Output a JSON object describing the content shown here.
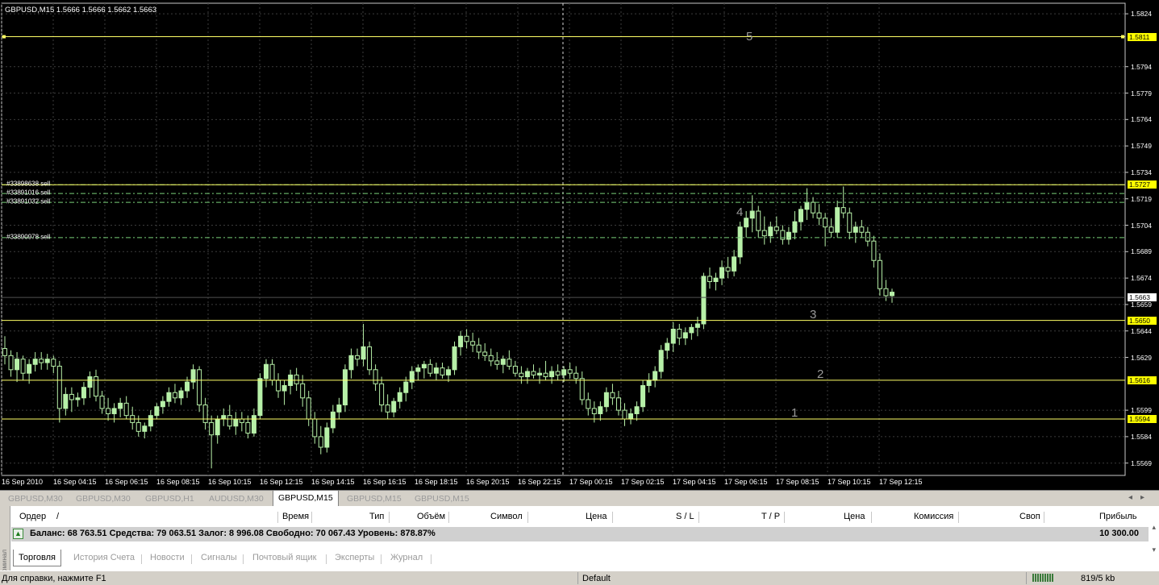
{
  "chart": {
    "header": "GBPUSD,M15  1.5666 1.5666 1.5662 1.5663",
    "price_axis": [
      "1.5824",
      "1.5794",
      "1.5779",
      "1.5764",
      "1.5749",
      "1.5734",
      "1.5719",
      "1.5704",
      "1.5689",
      "1.5674",
      "1.5659",
      "1.5644",
      "1.5629",
      "1.5599",
      "1.5584",
      "1.5569"
    ],
    "highlight_prices": [
      {
        "value": "1.5811",
        "kind": "level"
      },
      {
        "value": "1.5727",
        "kind": "level"
      },
      {
        "value": "1.5663",
        "kind": "current"
      },
      {
        "value": "1.5650",
        "kind": "level"
      },
      {
        "value": "1.5616",
        "kind": "level"
      },
      {
        "value": "1.5594",
        "kind": "level"
      }
    ],
    "time_axis": [
      "16 Sep 2010",
      "16 Sep 04:15",
      "16 Sep 06:15",
      "16 Sep 08:15",
      "16 Sep 10:15",
      "16 Sep 12:15",
      "16 Sep 14:15",
      "16 Sep 16:15",
      "16 Sep 18:15",
      "16 Sep 20:15",
      "16 Sep 22:15",
      "17 Sep 00:15",
      "17 Sep 02:15",
      "17 Sep 04:15",
      "17 Sep 06:15",
      "17 Sep 08:15",
      "17 Sep 10:15",
      "17 Sep 12:15"
    ],
    "order_labels": [
      {
        "text": "#33898638 sell",
        "price": 1.5727
      },
      {
        "text": "#33891016 sell",
        "price": 1.5722
      },
      {
        "text": "#33891032 sell",
        "price": 1.5717
      },
      {
        "text": "#33890978 sell",
        "price": 1.5697
      }
    ],
    "level_numbers": [
      {
        "text": "5",
        "price": 1.5811
      },
      {
        "text": "4",
        "price": 1.5711
      },
      {
        "text": "3",
        "price": 1.5653
      },
      {
        "text": "2",
        "price": 1.5619
      },
      {
        "text": "1",
        "price": 1.5597
      }
    ],
    "colors": {
      "background": "#000000",
      "grid": "#3c3c3c",
      "level": "#ffff66",
      "order_line": "#7ad07a",
      "candle": "#b7f0a8"
    }
  },
  "chart_data": {
    "type": "candlestick",
    "symbol": "GBPUSD",
    "timeframe": "M15",
    "ylim": [
      1.5562,
      1.583
    ],
    "candles": [
      [
        1.5634,
        1.5641,
        1.5625,
        1.563
      ],
      [
        1.563,
        1.5633,
        1.5618,
        1.5622
      ],
      [
        1.5622,
        1.5632,
        1.5615,
        1.5628
      ],
      [
        1.5628,
        1.563,
        1.5616,
        1.562
      ],
      [
        1.562,
        1.5628,
        1.5614,
        1.5625
      ],
      [
        1.5625,
        1.5632,
        1.5621,
        1.5628
      ],
      [
        1.5628,
        1.5632,
        1.5622,
        1.5626
      ],
      [
        1.5626,
        1.5631,
        1.5622,
        1.5628
      ],
      [
        1.5628,
        1.563,
        1.562,
        1.5624
      ],
      [
        1.5624,
        1.5627,
        1.5592,
        1.56
      ],
      [
        1.56,
        1.5612,
        1.5596,
        1.5608
      ],
      [
        1.5608,
        1.5612,
        1.5598,
        1.5605
      ],
      [
        1.5605,
        1.5609,
        1.5601,
        1.5606
      ],
      [
        1.5606,
        1.5615,
        1.5602,
        1.5612
      ],
      [
        1.5612,
        1.5621,
        1.5606,
        1.5618
      ],
      [
        1.5618,
        1.5622,
        1.5604,
        1.5607
      ],
      [
        1.5607,
        1.561,
        1.5597,
        1.56
      ],
      [
        1.56,
        1.5606,
        1.5593,
        1.5597
      ],
      [
        1.5597,
        1.5603,
        1.5592,
        1.56
      ],
      [
        1.56,
        1.5606,
        1.5595,
        1.5603
      ],
      [
        1.5603,
        1.5607,
        1.5594,
        1.5596
      ],
      [
        1.5596,
        1.5601,
        1.5588,
        1.5592
      ],
      [
        1.5592,
        1.5596,
        1.5584,
        1.5587
      ],
      [
        1.5587,
        1.5592,
        1.5583,
        1.559
      ],
      [
        1.559,
        1.5599,
        1.5587,
        1.5596
      ],
      [
        1.5596,
        1.5603,
        1.5594,
        1.5601
      ],
      [
        1.5601,
        1.5607,
        1.5597,
        1.5604
      ],
      [
        1.5604,
        1.5612,
        1.5601,
        1.5609
      ],
      [
        1.5609,
        1.5614,
        1.5603,
        1.5606
      ],
      [
        1.5606,
        1.5612,
        1.5602,
        1.561
      ],
      [
        1.561,
        1.5618,
        1.5606,
        1.5615
      ],
      [
        1.5615,
        1.5625,
        1.5611,
        1.5622
      ],
      [
        1.5622,
        1.5624,
        1.5598,
        1.5602
      ],
      [
        1.5602,
        1.5606,
        1.5588,
        1.5592
      ],
      [
        1.5592,
        1.5596,
        1.5566,
        1.5585
      ],
      [
        1.5585,
        1.5596,
        1.558,
        1.5594
      ],
      [
        1.5594,
        1.56,
        1.559,
        1.5596
      ],
      [
        1.5596,
        1.5602,
        1.5588,
        1.559
      ],
      [
        1.559,
        1.5598,
        1.5585,
        1.5594
      ],
      [
        1.5594,
        1.5598,
        1.5587,
        1.5592
      ],
      [
        1.5592,
        1.5596,
        1.5583,
        1.5586
      ],
      [
        1.5586,
        1.56,
        1.5584,
        1.5596
      ],
      [
        1.5596,
        1.562,
        1.5594,
        1.5617
      ],
      [
        1.5617,
        1.5628,
        1.5612,
        1.5625
      ],
      [
        1.5625,
        1.5628,
        1.5613,
        1.5616
      ],
      [
        1.5616,
        1.562,
        1.5606,
        1.561
      ],
      [
        1.561,
        1.5616,
        1.5602,
        1.5613
      ],
      [
        1.5613,
        1.5622,
        1.5608,
        1.5619
      ],
      [
        1.5619,
        1.5623,
        1.561,
        1.5614
      ],
      [
        1.5614,
        1.5619,
        1.5601,
        1.5606
      ],
      [
        1.5606,
        1.561,
        1.559,
        1.5594
      ],
      [
        1.5594,
        1.5598,
        1.558,
        1.5584
      ],
      [
        1.5584,
        1.559,
        1.5574,
        1.5578
      ],
      [
        1.5578,
        1.5592,
        1.5575,
        1.5589
      ],
      [
        1.5589,
        1.5602,
        1.5586,
        1.5598
      ],
      [
        1.5598,
        1.5606,
        1.5594,
        1.5602
      ],
      [
        1.5602,
        1.5625,
        1.5598,
        1.5622
      ],
      [
        1.5622,
        1.5634,
        1.5617,
        1.563
      ],
      [
        1.563,
        1.5634,
        1.5624,
        1.5628
      ],
      [
        1.5628,
        1.5648,
        1.5624,
        1.5635
      ],
      [
        1.5635,
        1.5638,
        1.5619,
        1.5622
      ],
      [
        1.5622,
        1.5625,
        1.561,
        1.5614
      ],
      [
        1.5614,
        1.5618,
        1.5598,
        1.5602
      ],
      [
        1.5602,
        1.5608,
        1.5594,
        1.5598
      ],
      [
        1.5598,
        1.5606,
        1.5595,
        1.5604
      ],
      [
        1.5604,
        1.5612,
        1.56,
        1.5609
      ],
      [
        1.5609,
        1.5618,
        1.5604,
        1.5615
      ],
      [
        1.5615,
        1.5624,
        1.5611,
        1.5621
      ],
      [
        1.5621,
        1.5625,
        1.5616,
        1.5623
      ],
      [
        1.5623,
        1.5627,
        1.5617,
        1.5625
      ],
      [
        1.5625,
        1.5628,
        1.5618,
        1.562
      ],
      [
        1.562,
        1.5626,
        1.5616,
        1.5623
      ],
      [
        1.5623,
        1.5626,
        1.5617,
        1.5619
      ],
      [
        1.5619,
        1.5624,
        1.5615,
        1.5622
      ],
      [
        1.5622,
        1.5638,
        1.5619,
        1.5635
      ],
      [
        1.5635,
        1.5644,
        1.563,
        1.5641
      ],
      [
        1.5641,
        1.5645,
        1.5634,
        1.5638
      ],
      [
        1.5638,
        1.5643,
        1.5632,
        1.5636
      ],
      [
        1.5636,
        1.564,
        1.5628,
        1.5632
      ],
      [
        1.5632,
        1.5637,
        1.5627,
        1.563
      ],
      [
        1.563,
        1.5634,
        1.5624,
        1.5627
      ],
      [
        1.5627,
        1.5632,
        1.5622,
        1.5625
      ],
      [
        1.5625,
        1.563,
        1.562,
        1.5628
      ],
      [
        1.5628,
        1.5633,
        1.5622,
        1.5624
      ],
      [
        1.5624,
        1.5627,
        1.5618,
        1.562
      ],
      [
        1.562,
        1.5624,
        1.5614,
        1.5618
      ],
      [
        1.5618,
        1.5623,
        1.5614,
        1.5621
      ],
      [
        1.5621,
        1.5625,
        1.5617,
        1.5619
      ],
      [
        1.5619,
        1.5623,
        1.5614,
        1.562
      ],
      [
        1.562,
        1.5627,
        1.5616,
        1.5618
      ],
      [
        1.5618,
        1.5624,
        1.5614,
        1.5621
      ],
      [
        1.5621,
        1.5625,
        1.5616,
        1.5619
      ],
      [
        1.5619,
        1.5624,
        1.5615,
        1.5622
      ],
      [
        1.5622,
        1.5626,
        1.5617,
        1.562
      ],
      [
        1.562,
        1.5624,
        1.5614,
        1.5617
      ],
      [
        1.5617,
        1.5621,
        1.5602,
        1.5605
      ],
      [
        1.5605,
        1.5609,
        1.5596,
        1.56
      ],
      [
        1.56,
        1.5604,
        1.5592,
        1.5597
      ],
      [
        1.5597,
        1.5604,
        1.5593,
        1.5601
      ],
      [
        1.5601,
        1.5612,
        1.5598,
        1.5609
      ],
      [
        1.5609,
        1.5614,
        1.5602,
        1.5606
      ],
      [
        1.5606,
        1.561,
        1.5596,
        1.5599
      ],
      [
        1.5599,
        1.5603,
        1.559,
        1.5594
      ],
      [
        1.5594,
        1.56,
        1.5591,
        1.5597
      ],
      [
        1.5597,
        1.5604,
        1.5593,
        1.5601
      ],
      [
        1.5601,
        1.5616,
        1.5598,
        1.5613
      ],
      [
        1.5613,
        1.562,
        1.5609,
        1.5616
      ],
      [
        1.5616,
        1.5624,
        1.5612,
        1.5621
      ],
      [
        1.5621,
        1.5636,
        1.5617,
        1.5633
      ],
      [
        1.5633,
        1.564,
        1.5628,
        1.5637
      ],
      [
        1.5637,
        1.5649,
        1.5632,
        1.5645
      ],
      [
        1.5645,
        1.5648,
        1.5636,
        1.564
      ],
      [
        1.564,
        1.5646,
        1.5636,
        1.5643
      ],
      [
        1.5643,
        1.5648,
        1.5639,
        1.5646
      ],
      [
        1.5646,
        1.5652,
        1.5641,
        1.5648
      ],
      [
        1.5648,
        1.5677,
        1.5645,
        1.5675
      ],
      [
        1.5675,
        1.568,
        1.5668,
        1.5672
      ],
      [
        1.5672,
        1.5677,
        1.5667,
        1.5674
      ],
      [
        1.5674,
        1.5684,
        1.567,
        1.568
      ],
      [
        1.568,
        1.5686,
        1.5674,
        1.5678
      ],
      [
        1.5678,
        1.569,
        1.5675,
        1.5686
      ],
      [
        1.5686,
        1.5706,
        1.5682,
        1.5703
      ],
      [
        1.5703,
        1.5712,
        1.5697,
        1.5708
      ],
      [
        1.5708,
        1.5721,
        1.57,
        1.5712
      ],
      [
        1.5712,
        1.5715,
        1.5697,
        1.5701
      ],
      [
        1.5701,
        1.5709,
        1.5693,
        1.5698
      ],
      [
        1.5698,
        1.5706,
        1.5694,
        1.5703
      ],
      [
        1.5703,
        1.5709,
        1.5699,
        1.5701
      ],
      [
        1.5701,
        1.5704,
        1.5693,
        1.5696
      ],
      [
        1.5696,
        1.5703,
        1.5693,
        1.57
      ],
      [
        1.57,
        1.5712,
        1.5696,
        1.5706
      ],
      [
        1.5706,
        1.5715,
        1.5701,
        1.5713
      ],
      [
        1.5713,
        1.5725,
        1.5707,
        1.5717
      ],
      [
        1.5717,
        1.572,
        1.5708,
        1.5711
      ],
      [
        1.5711,
        1.5716,
        1.5704,
        1.5708
      ],
      [
        1.5708,
        1.5711,
        1.5692,
        1.5703
      ],
      [
        1.5703,
        1.5708,
        1.5697,
        1.57
      ],
      [
        1.57,
        1.5718,
        1.5697,
        1.5714
      ],
      [
        1.5714,
        1.5726,
        1.5708,
        1.5711
      ],
      [
        1.5711,
        1.5714,
        1.5696,
        1.57
      ],
      [
        1.57,
        1.5706,
        1.5694,
        1.5703
      ],
      [
        1.5703,
        1.5707,
        1.5697,
        1.57
      ],
      [
        1.57,
        1.5703,
        1.5692,
        1.5695
      ],
      [
        1.5695,
        1.5698,
        1.568,
        1.5684
      ],
      [
        1.5684,
        1.5688,
        1.5664,
        1.5668
      ],
      [
        1.5668,
        1.5673,
        1.5661,
        1.5664
      ],
      [
        1.5664,
        1.5668,
        1.566,
        1.5666
      ]
    ]
  },
  "chart_tabs": [
    {
      "label": "GBPUSD,M30",
      "active": false
    },
    {
      "label": "GBPUSD,M30",
      "active": false
    },
    {
      "label": "GBPUSD,H1",
      "active": false
    },
    {
      "label": "AUDUSD,M30",
      "active": false
    },
    {
      "label": "GBPUSD,M15",
      "active": true
    },
    {
      "label": "GBPUSD,M15",
      "active": false
    },
    {
      "label": "GBPUSD,M15",
      "active": false
    }
  ],
  "terminal": {
    "sidebar_label": "Терминал",
    "columns": [
      "Ордер",
      "/",
      "Время",
      "Тип",
      "Объём",
      "Символ",
      "Цена",
      "S / L",
      "T / P",
      "Цена",
      "Комиссия",
      "Своп",
      "Прибыль"
    ],
    "balance_line": "Баланс: 68 763.51  Средства: 79 063.51  Залог: 8 996.08  Свободно: 70 067.43  Уровень: 878.87%",
    "profit": "10 300.00",
    "tabs": [
      "Торговля",
      "История Счета",
      "Новости",
      "Сигналы",
      "Почтовый ящик",
      "Эксперты",
      "Журнал"
    ],
    "active_tab": "Торговля"
  },
  "status_bar": {
    "help": "Для справки, нажмите F1",
    "profile": "Default",
    "traffic": "819/5 kb"
  }
}
